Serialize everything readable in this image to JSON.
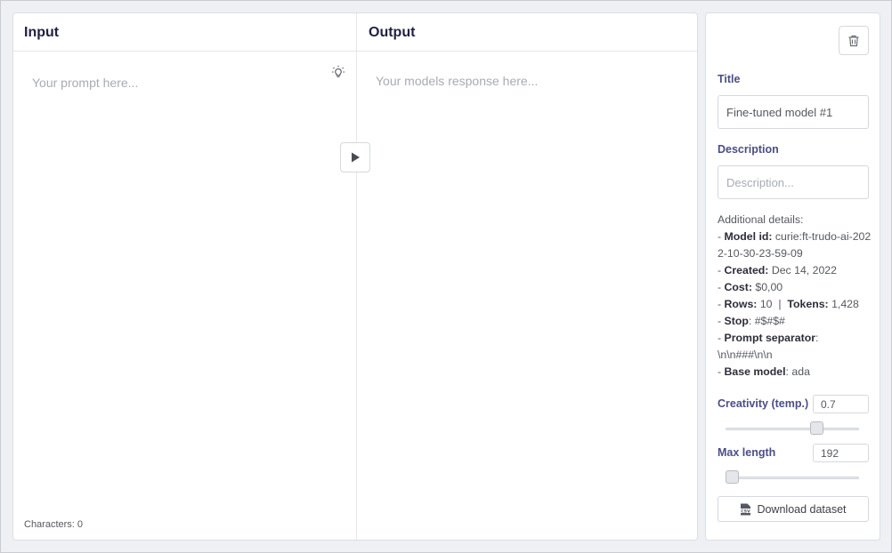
{
  "input": {
    "header": "Input",
    "placeholder": "Your prompt here...",
    "characters": "Characters: 0"
  },
  "output": {
    "header": "Output",
    "placeholder": "Your models response here..."
  },
  "sidebar": {
    "title_label": "Title",
    "title_value": "Fine-tuned model #1",
    "description_label": "Description",
    "description_placeholder": "Description...",
    "details": {
      "heading": "Additional details:",
      "model_id_label": "Model id:",
      "model_id": "curie:ft-trudo-ai-2022-10-30-23-59-09",
      "created_label": "Created:",
      "created": "Dec 14, 2022",
      "cost_label": "Cost:",
      "cost": "$0,00",
      "rows_label": "Rows:",
      "rows": "10",
      "tokens_label": "Tokens:",
      "tokens": "1,428",
      "stop_label": "Stop",
      "stop": "#$#$#",
      "prompt_separator_label": "Prompt separator",
      "prompt_separator": "\\n\\n###\\n\\n",
      "base_model_label": "Base model",
      "base_model": "ada"
    },
    "creativity_label": "Creativity (temp.)",
    "creativity_value": "0.7",
    "creativity_fraction": 0.7,
    "max_length_label": "Max length",
    "max_length_value": "192",
    "max_length_fraction": 0.0,
    "download_label": "Download dataset"
  },
  "icons": {
    "bulb": "lightbulb-icon",
    "run": "play-icon",
    "delete": "trash-icon",
    "csv": "csv-file-icon"
  }
}
